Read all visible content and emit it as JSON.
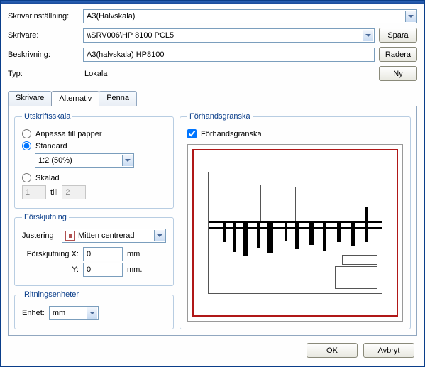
{
  "labels": {
    "skrivarinstallning": "Skrivarinställning:",
    "skrivare": "Skrivare:",
    "beskrivning": "Beskrivning:",
    "typ": "Typ:"
  },
  "values": {
    "skrivarinstallning": "A3(Halvskala)",
    "skrivare": "\\\\SRV006\\HP 8100 PCL5",
    "beskrivning": "A3(halvskala) HP8100",
    "typ": "Lokala"
  },
  "buttons": {
    "spara": "Spara",
    "radera": "Radera",
    "ny": "Ny",
    "ok": "OK",
    "avbryt": "Avbryt"
  },
  "tabs": {
    "skrivare": "Skrivare",
    "alternativ": "Alternativ",
    "penna": "Penna"
  },
  "groups": {
    "utskriftsskala": "Utskriftsskala",
    "forskjutning": "Förskjutning",
    "ritningsenheter": "Ritningsenheter",
    "forhandsgranska": "Förhandsgranska"
  },
  "scale": {
    "anpassa": "Anpassa till papper",
    "standard": "Standard",
    "standard_value": "1:2  (50%)",
    "skalad": "Skalad",
    "skalad_from": "1",
    "till": "till",
    "skalad_to": "2"
  },
  "offset": {
    "justering": "Justering",
    "justering_value": "Mitten centrerad",
    "forskjutning_x": "Förskjutning X:",
    "y": "Y:",
    "x_val": "0",
    "y_val": "0",
    "mm": "mm",
    "mm2": "mm."
  },
  "units": {
    "enhet": "Enhet:",
    "enhet_value": "mm"
  },
  "preview": {
    "checkbox": "Förhandsgranska"
  }
}
